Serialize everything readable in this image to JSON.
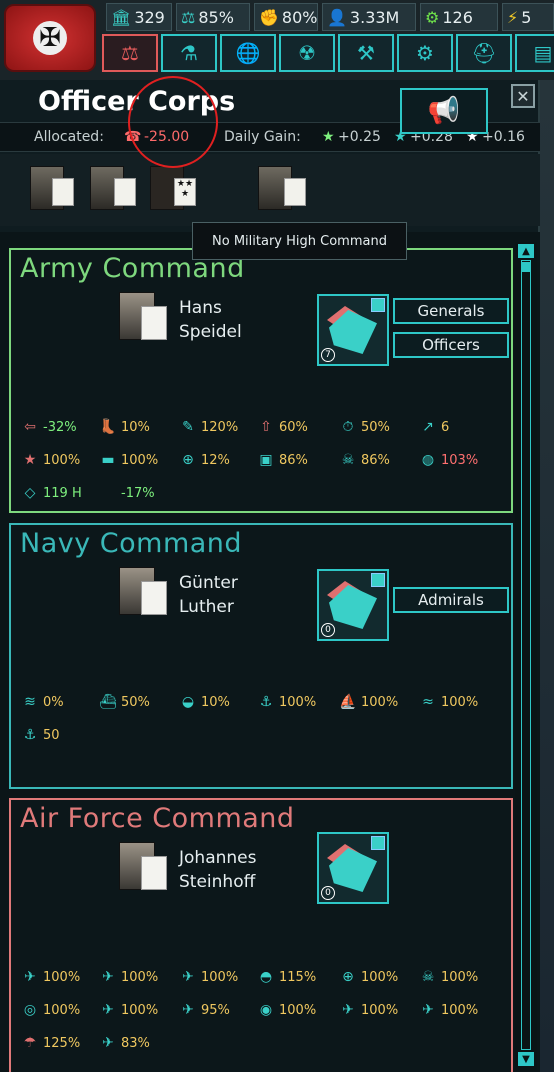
{
  "resources": [
    {
      "icon": "bank-icon",
      "glyph": "🏛",
      "value": "329"
    },
    {
      "icon": "scales-icon",
      "glyph": "⚖",
      "value": "85%"
    },
    {
      "icon": "fist-icon",
      "glyph": "✊",
      "value": "80%"
    },
    {
      "icon": "manpower-icon",
      "glyph": "👤",
      "value": "3.33M"
    },
    {
      "icon": "industry-gear-icon",
      "glyph": "⚙",
      "value": "126"
    },
    {
      "icon": "lightning-icon",
      "glyph": "⚡",
      "value": "5"
    }
  ],
  "tabs": [
    {
      "name": "tab-government",
      "glyph": "⚖",
      "active": true
    },
    {
      "name": "tab-research",
      "glyph": "⚗"
    },
    {
      "name": "tab-diplomacy",
      "glyph": "🌐"
    },
    {
      "name": "tab-nuclear",
      "glyph": "☢"
    },
    {
      "name": "tab-production",
      "glyph": "⚒"
    },
    {
      "name": "tab-industry",
      "glyph": "⚙"
    },
    {
      "name": "tab-military",
      "glyph": "⛑"
    },
    {
      "name": "tab-more",
      "glyph": "▤"
    }
  ],
  "panel": {
    "title": "Officer Corps",
    "close": "✕",
    "allocated_label": "Allocated:",
    "allocated_value": "-25.00",
    "daily_gain_label": "Daily Gain:",
    "gains": [
      "+0.25",
      "+0.28",
      "+0.16"
    ],
    "tooltip": "No Military High Command"
  },
  "army": {
    "title": "Army Command",
    "name_line1": "Hans",
    "name_line2": "Speidel",
    "unit_num": "7",
    "buttons": [
      "Generals",
      "Officers"
    ],
    "stats": [
      {
        "icon": "retreat-icon",
        "value": "-32%",
        "neg": true
      },
      {
        "icon": "boot-icon",
        "value": "10%"
      },
      {
        "icon": "planning-icon",
        "value": "120%"
      },
      {
        "icon": "plan-up-icon",
        "value": "60%"
      },
      {
        "icon": "timer-icon",
        "value": "50%"
      },
      {
        "icon": "arrow-up-icon",
        "value": "6"
      },
      {
        "icon": "star-down-icon",
        "value": "100%"
      },
      {
        "icon": "tank-icon",
        "value": "100%"
      },
      {
        "icon": "target-icon",
        "value": "12%"
      },
      {
        "icon": "supply-icon",
        "value": "86%"
      },
      {
        "icon": "skull-icon",
        "value": "86%"
      },
      {
        "icon": "globe-icon",
        "value": "103%",
        "neg": true
      },
      {
        "icon": "terrain-icon",
        "value": "119 H"
      },
      {
        "icon": "blank",
        "value": "-17%"
      }
    ]
  },
  "navy": {
    "title": "Navy Command",
    "name_line1": "Günter",
    "name_line2": "Luther",
    "unit_num": "0",
    "buttons": [
      "Admirals"
    ],
    "stats": [
      {
        "icon": "wave-icon",
        "value": "0%"
      },
      {
        "icon": "ship-icon",
        "value": "50%"
      },
      {
        "icon": "submarine-icon",
        "value": "10%"
      },
      {
        "icon": "anchor-target-icon",
        "value": "100%"
      },
      {
        "icon": "fleet-icon",
        "value": "100%"
      },
      {
        "icon": "convoy-icon",
        "value": "100%"
      },
      {
        "icon": "anchor-icon",
        "value": "50"
      }
    ]
  },
  "airforce": {
    "title": "Air Force Command",
    "name_line1": "Johannes",
    "name_line2": "Steinhoff",
    "unit_num": "0",
    "stats": [
      {
        "icon": "plane-icon",
        "value": "100%"
      },
      {
        "icon": "fighter-icon",
        "value": "100%"
      },
      {
        "icon": "cas-icon",
        "value": "100%"
      },
      {
        "icon": "ufo-icon",
        "value": "115%"
      },
      {
        "icon": "crosshair-icon",
        "value": "100%"
      },
      {
        "icon": "skull-bomb-icon",
        "value": "100%"
      },
      {
        "icon": "radar-icon",
        "value": "100%"
      },
      {
        "icon": "naval-bomber-icon",
        "value": "100%"
      },
      {
        "icon": "jet-icon",
        "value": "95%"
      },
      {
        "icon": "eye-icon",
        "value": "100%"
      },
      {
        "icon": "transport-plane-icon",
        "value": "100%"
      },
      {
        "icon": "bomber-icon",
        "value": "100%"
      },
      {
        "icon": "paradrop-icon",
        "value": "125%"
      },
      {
        "icon": "alert-plane-icon",
        "value": "83%"
      }
    ]
  }
}
